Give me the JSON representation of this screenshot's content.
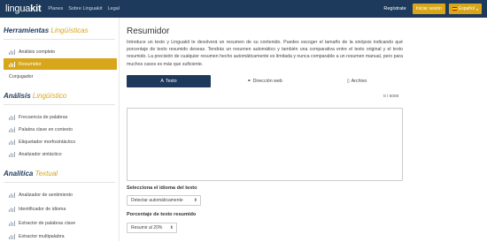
{
  "navbar": {
    "brand_a": "lingua",
    "brand_b": "kit",
    "links": [
      "Planes",
      "Sobre Linguakit",
      "Legal"
    ],
    "register": "Regístrate",
    "login": "Iniciar sesión",
    "language": "Español"
  },
  "sidebar": {
    "sections": [
      {
        "title": "Herramientas",
        "accent": "Lingüísticas",
        "items": [
          "Análisis completo",
          "Resumidor",
          "Conjugador"
        ]
      },
      {
        "title": "Análisis",
        "accent": "Lingüístico",
        "items": [
          "Frecuencia de palabras",
          "Palabra clave en contexto",
          "Etiquetador morfosintáctico",
          "Analizador sintáctico"
        ]
      },
      {
        "title": "Analítica",
        "accent": "Textual",
        "items": [
          "Analizador de sentimiento",
          "Identificador de idioma",
          "Extractor de palabras clave",
          "Extractor multipalabra"
        ]
      }
    ],
    "active_item": "Resumidor"
  },
  "main": {
    "title": "Resumidor",
    "intro": "Introduce un texto y Linguakit te devolverá un resumen de su contenido. Puedes escoger el tamaño de la sinópsis indicando qué porcentaje de texto resumido deseas. Tendrás un resumen automático y también una comparativa entre el texto original y el texto resumido. La precisión de cualquier resumen hecho automáticamente es limitada y nunca comparable a un resumen manual, pero para muchos casos es más que suficiente.",
    "tabs": [
      "Texto",
      "Dirección web",
      "Archivo"
    ],
    "counter": "0 / 5000",
    "language_label": "Selecciona el idioma del texto",
    "language_value": "Detectar automáticamente",
    "percent_label": "Porcentaje de texto resumido",
    "percent_value": "Resumir al 20%"
  },
  "colors": {
    "navy": "#1d3a5c",
    "accent": "#d8a61a"
  },
  "icons": [
    "spain-flag-icon",
    "chart-bars-icon",
    "font-icon",
    "link-icon",
    "file-icon",
    "caret-down-icon"
  ]
}
